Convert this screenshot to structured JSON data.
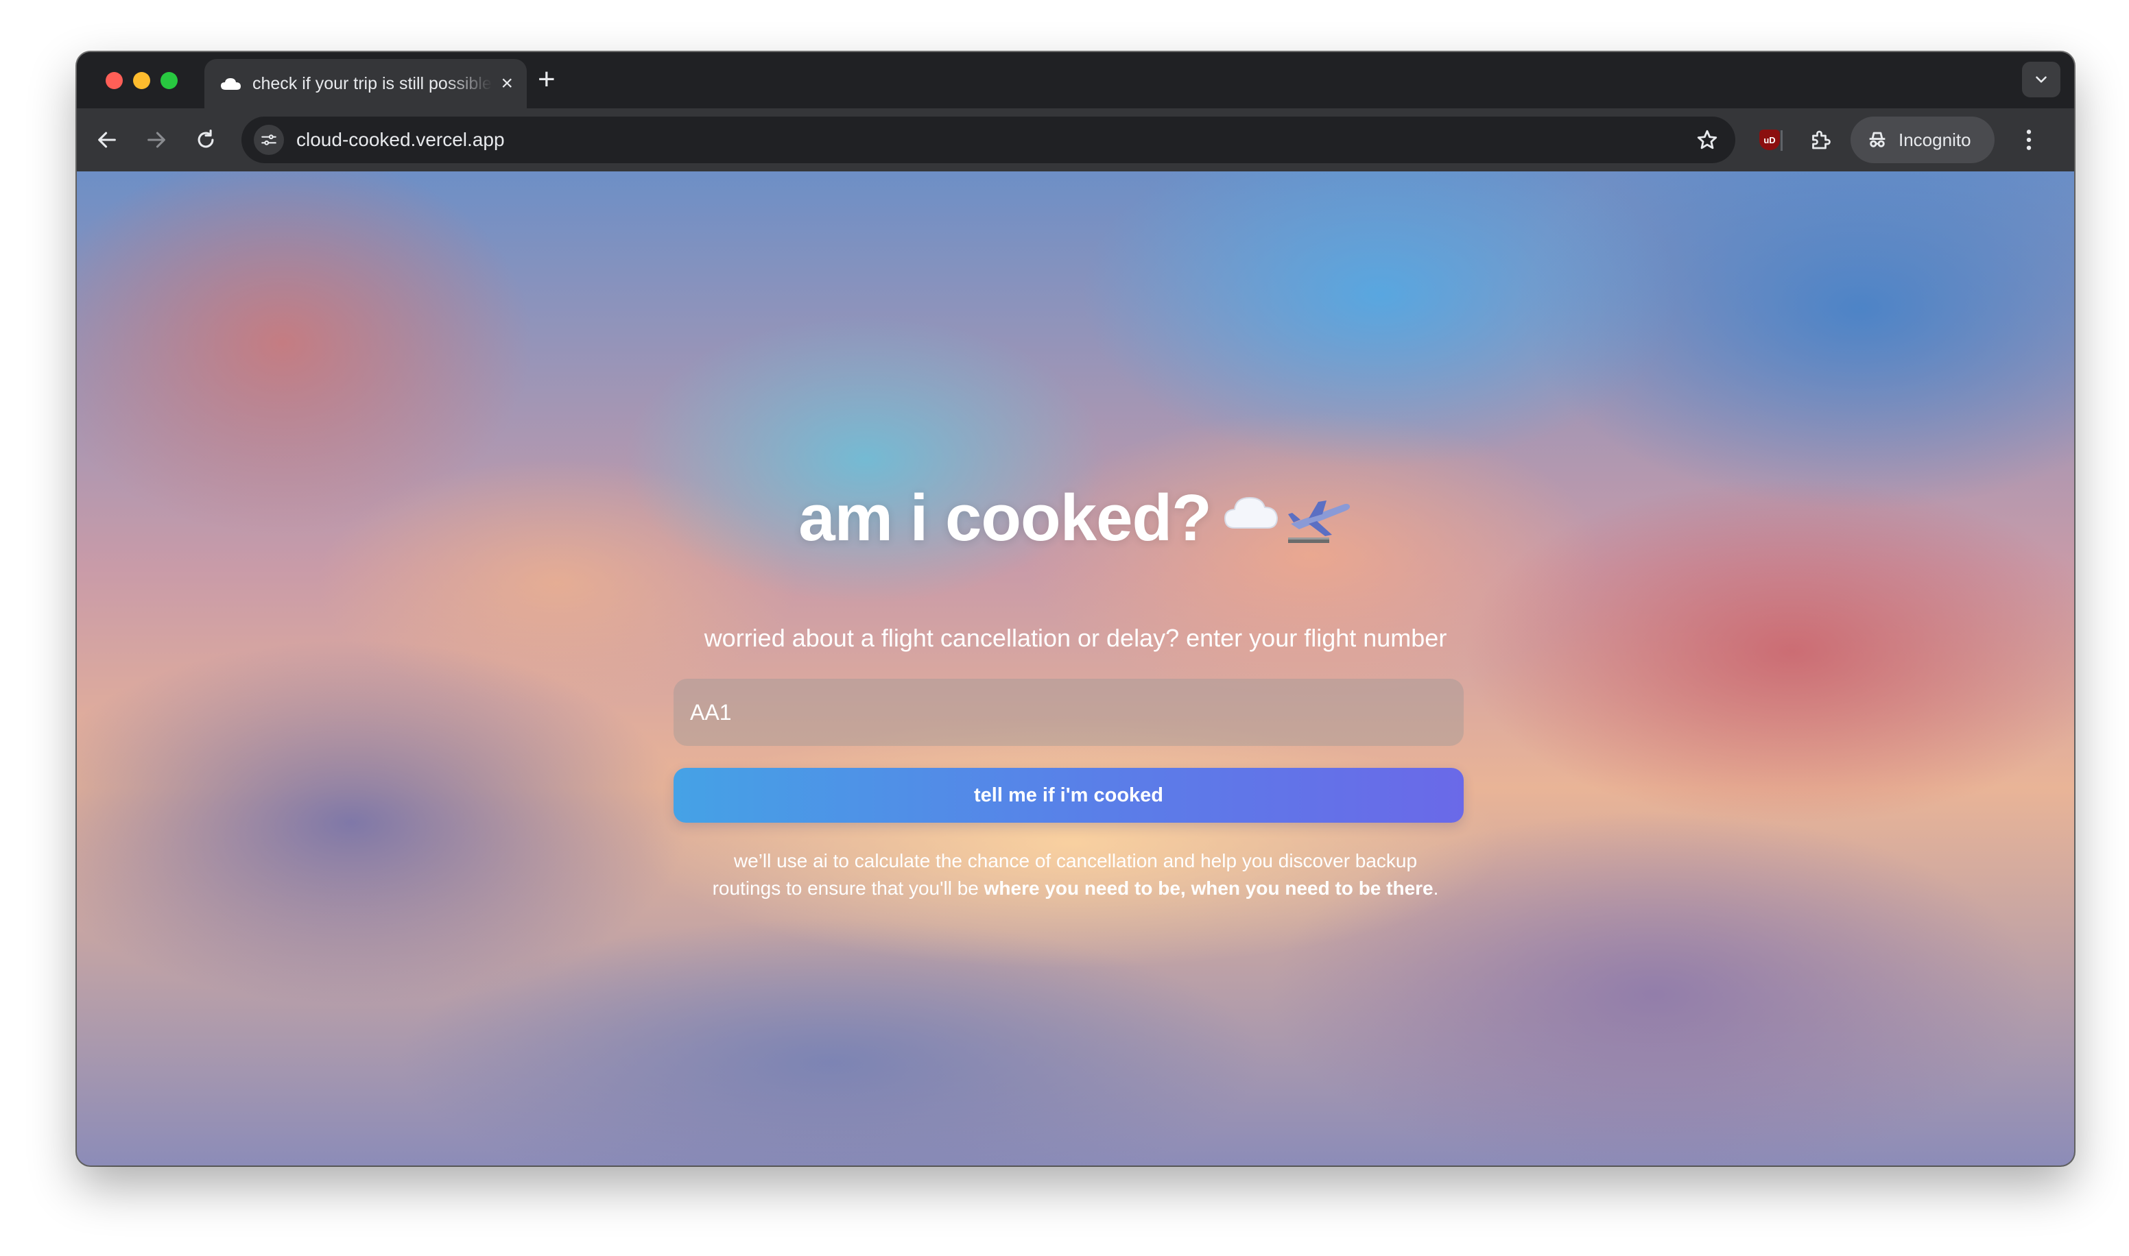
{
  "browser": {
    "tab": {
      "title": "check if your trip is still possible",
      "favicon": "cloud-icon"
    },
    "new_tab_label": "+",
    "url": "cloud-cooked.vercel.app",
    "incognito_label": "Incognito",
    "icons": [
      "back-icon",
      "forward-icon",
      "reload-icon",
      "site-info-icon",
      "bookmark-star-icon",
      "ublock-icon",
      "extensions-icon",
      "side-panel-icon",
      "incognito-icon",
      "menu-icon",
      "tab-search-icon"
    ]
  },
  "page": {
    "headline": "am i cooked?",
    "headline_emoji": "☁️🛬",
    "subtitle": "worried about a flight cancellation or delay? enter your flight number",
    "flight_input": {
      "value": "AA1",
      "placeholder": ""
    },
    "submit_label": "tell me if i'm cooked",
    "explanation": {
      "plain": "we’ll use ai to calculate the chance of cancellation and help you discover backup routings to ensure that you'll be ",
      "bold": "where you need to be, when you need to be there",
      "end": "."
    }
  },
  "colors": {
    "button_gradient_start": "#45a2e6",
    "button_gradient_end": "#6a69e8",
    "text": "#ffffff",
    "browser_frame": "#202124",
    "toolbar": "#353639"
  }
}
